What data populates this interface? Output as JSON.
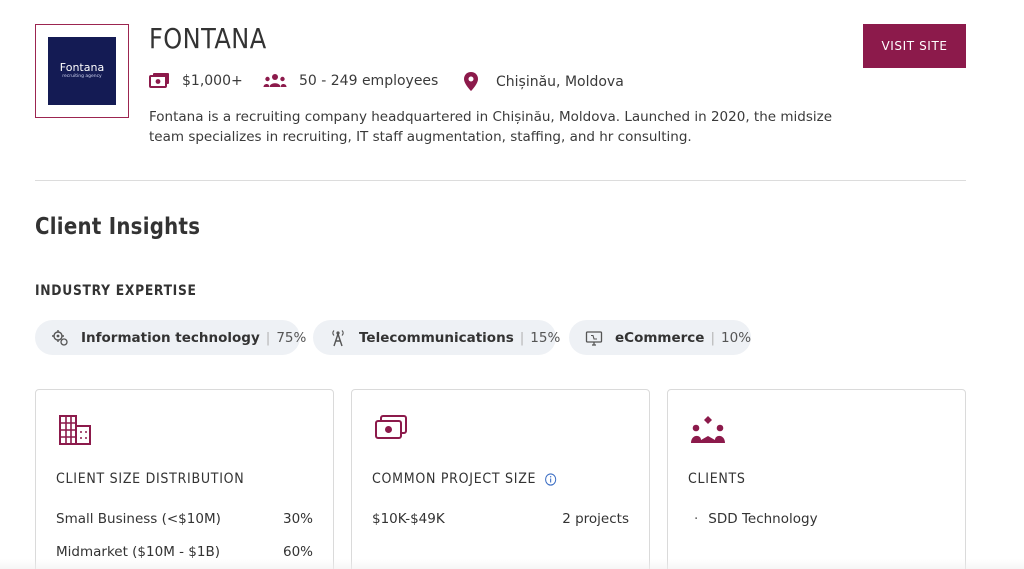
{
  "company": {
    "logo_name": "Fontana",
    "logo_tagline": "recruiting agency",
    "name": "FONTANA",
    "min_project_size": "$1,000+",
    "employees": "50 - 249 employees",
    "location": "Chișinău, Moldova",
    "description": "Fontana is a recruiting company headquartered in Chișinău, Moldova. Launched in 2020, the midsize team specializes in recruiting, IT staff augmentation, staffing, and hr consulting."
  },
  "header": {
    "visit_label": "VISIT SITE"
  },
  "insights": {
    "title": "Client Insights",
    "industry_label": "INDUSTRY EXPERTISE",
    "industries": [
      {
        "label": "Information technology",
        "pct": "75%",
        "icon": "gears-icon"
      },
      {
        "label": "Telecommunications",
        "pct": "15%",
        "icon": "antenna-icon"
      },
      {
        "label": "eCommerce",
        "pct": "10%",
        "icon": "monitor-icon"
      }
    ]
  },
  "cards": {
    "client_size": {
      "title": "CLIENT SIZE DISTRIBUTION",
      "icon": "building-icon",
      "rows": [
        {
          "label": "Small Business (<$10M)",
          "value": "30%"
        },
        {
          "label": "Midmarket ($10M - $1B)",
          "value": "60%"
        }
      ]
    },
    "project_size": {
      "title": "COMMON PROJECT SIZE",
      "icon": "money-icon",
      "rows": [
        {
          "label": "$10K-$49K",
          "value": "2 projects"
        }
      ]
    },
    "clients": {
      "title": "CLIENTS",
      "icon": "people-icon",
      "items": [
        "SDD Technology"
      ]
    }
  },
  "colors": {
    "accent": "#8c1a4b",
    "logo_bg": "#141b54",
    "chip_bg": "#eef1f5",
    "info_blue": "#3d6fc4"
  }
}
